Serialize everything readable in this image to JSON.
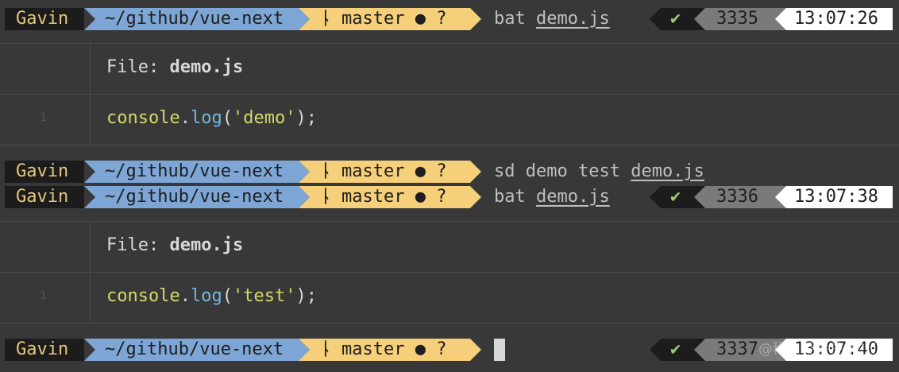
{
  "prompts": [
    {
      "user": "Gavin",
      "path": "~/github/vue-next",
      "branch": "master ● ?",
      "cmd": "bat",
      "arg": "demo.js",
      "status": "✔",
      "count": "3335",
      "time": "13:07:26"
    },
    {
      "user": "Gavin",
      "path": "~/github/vue-next",
      "branch": "master ● ?",
      "cmd": "sd demo test",
      "arg": "demo.js"
    },
    {
      "user": "Gavin",
      "path": "~/github/vue-next",
      "branch": "master ● ?",
      "cmd": "bat",
      "arg": "demo.js",
      "status": "✔",
      "count": "3336",
      "time": "13:07:38"
    },
    {
      "user": "Gavin",
      "path": "~/github/vue-next",
      "branch": "master ● ?",
      "status": "✔",
      "count": "3337",
      "time": "13:07:40"
    }
  ],
  "outputs": [
    {
      "file_label": "File:",
      "file_name": "demo.js",
      "line_no": "1",
      "obj": "console",
      "dot": ".",
      "fn": "log",
      "open": "(",
      "str": "'demo'",
      "close": ");"
    },
    {
      "file_label": "File:",
      "file_name": "demo.js",
      "line_no": "1",
      "obj": "console",
      "dot": ".",
      "fn": "log",
      "open": "(",
      "str": "'test'",
      "close": ");"
    }
  ],
  "icons": {
    "branch": "git-branch-icon"
  },
  "watermark": "@稀土掘金技术社区",
  "colors": {
    "background": "#383838",
    "path": "#7da6d6",
    "git": "#f5cf7a",
    "success": "#9fc97a"
  }
}
